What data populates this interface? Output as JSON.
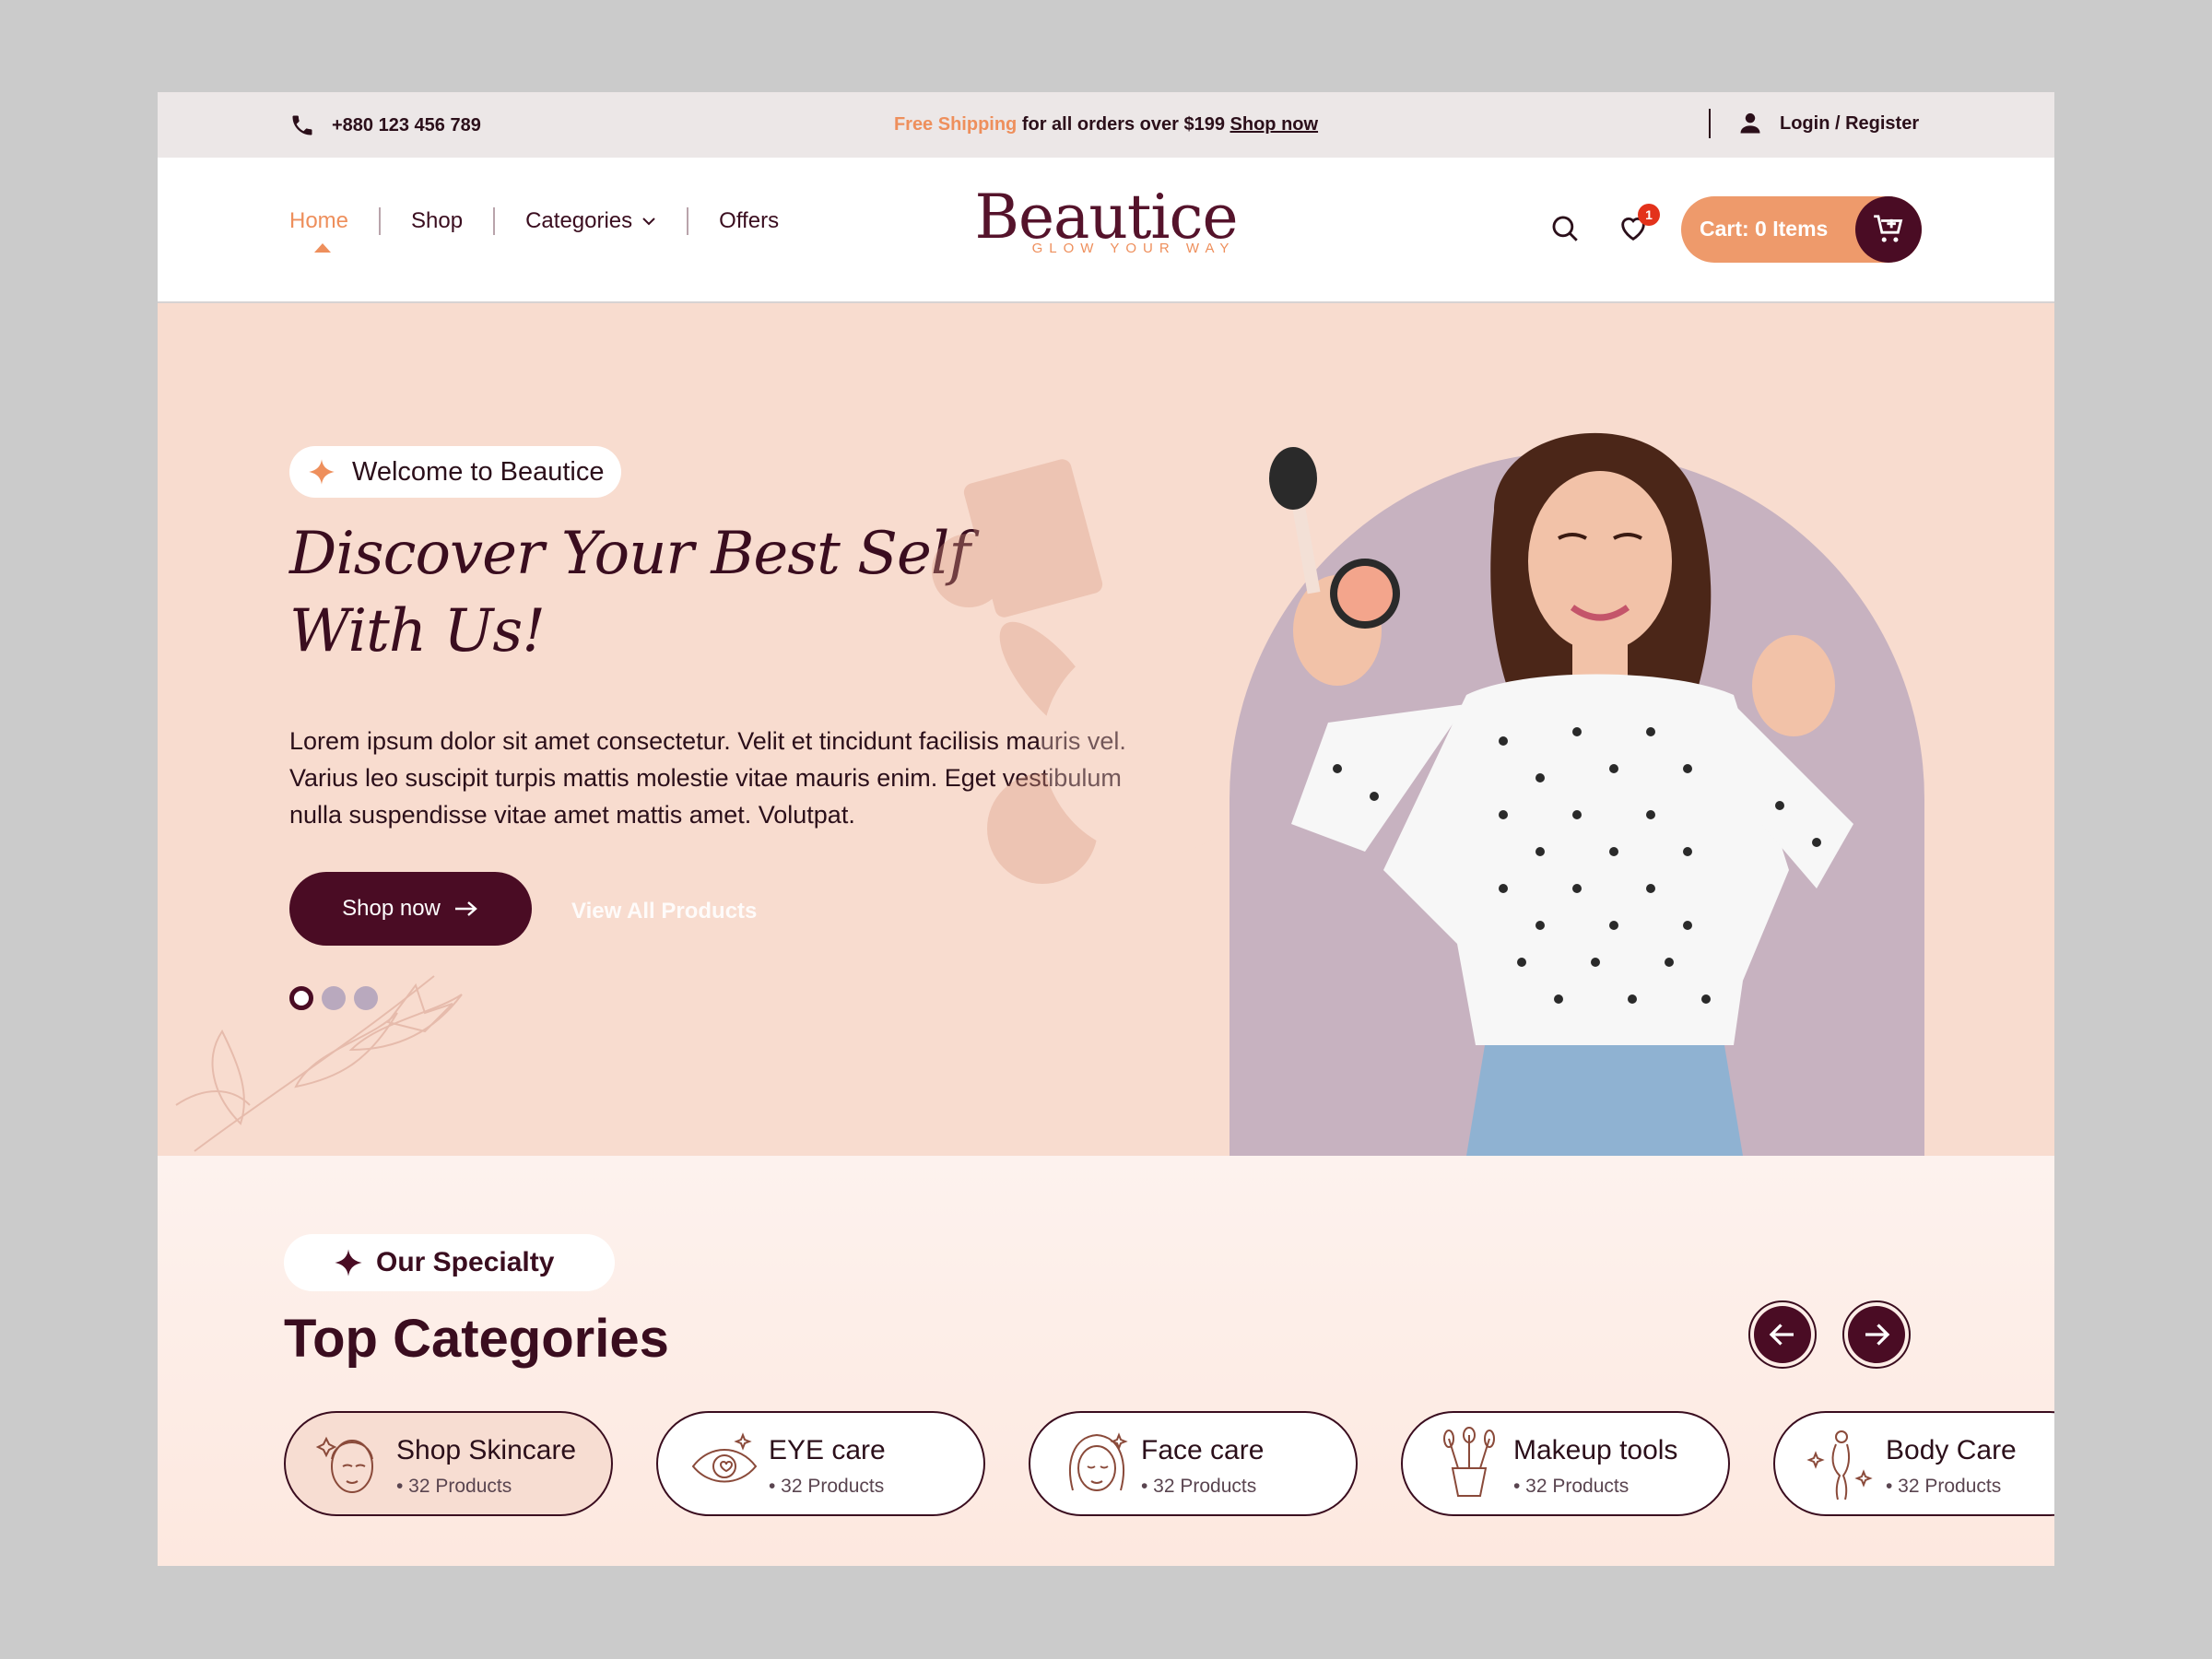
{
  "topbar": {
    "phone": "+880 123  456 789",
    "shipping_accent": "Free Shipping",
    "shipping_text": " for all orders over $199 ",
    "shipping_link": "Shop now",
    "login": "Login / Register"
  },
  "nav": {
    "items": [
      {
        "label": "Home",
        "active": true
      },
      {
        "label": "Shop"
      },
      {
        "label": "Categories"
      },
      {
        "label": "Offers"
      }
    ]
  },
  "brand": {
    "name": "Beautice",
    "tagline": "GLOW YOUR WAY"
  },
  "header": {
    "wishlist_count": "1",
    "cart_label": "Cart: 0 Items"
  },
  "hero": {
    "welcome": "Welcome to Beautice",
    "title_line1": "Discover Your Best Self",
    "title_line2": "With Us!",
    "text": "Lorem ipsum dolor sit amet consectetur. Velit et tincidunt facilisis mauris vel. Varius leo suscipit turpis mattis molestie vitae mauris enim. Eget vestibulum nulla suspendisse vitae amet mattis amet. Volutpat.",
    "primary_cta": "Shop now",
    "secondary_cta": "View All Products",
    "slides_total": 3,
    "slide_active": 1
  },
  "specialty": {
    "badge": "Our Specialty",
    "title": "Top Categories",
    "categories": [
      {
        "name": "Shop Skincare",
        "count": "• 32 Products",
        "icon": "skincare-face-icon"
      },
      {
        "name": "EYE care",
        "count": "• 32 Products",
        "icon": "eye-icon"
      },
      {
        "name": "Face care",
        "count": "• 32 Products",
        "icon": "face-icon"
      },
      {
        "name": "Makeup tools",
        "count": "• 32 Products",
        "icon": "makeup-brushes-icon"
      },
      {
        "name": "Body Care",
        "count": "• 32 Products",
        "icon": "body-icon"
      }
    ]
  },
  "colors": {
    "primary": "#4a0c24",
    "accent": "#ee8f5c",
    "hero_bg": "#f8dccf",
    "arch": "#c7b2c0"
  }
}
